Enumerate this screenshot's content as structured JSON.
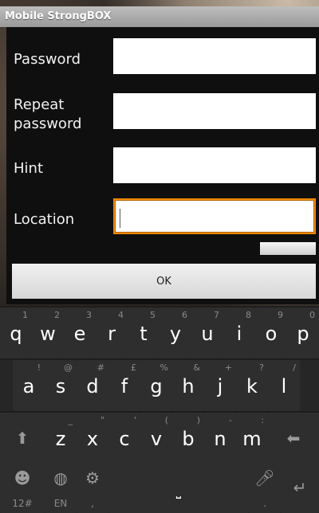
{
  "app": {
    "title": "Mobile StrongBOX"
  },
  "form": {
    "password_label": "Password",
    "repeat_label_1": "Repeat",
    "repeat_label_2": "password",
    "hint_label": "Hint",
    "location_label": "Location",
    "password_value": "",
    "repeat_value": "",
    "hint_value": "",
    "location_value": "",
    "ok_label": "OK"
  },
  "keyboard": {
    "row1": [
      {
        "key": "q",
        "hint": "1"
      },
      {
        "key": "w",
        "hint": "2"
      },
      {
        "key": "e",
        "hint": "3"
      },
      {
        "key": "r",
        "hint": "4"
      },
      {
        "key": "t",
        "hint": "5"
      },
      {
        "key": "y",
        "hint": "6"
      },
      {
        "key": "u",
        "hint": "7"
      },
      {
        "key": "i",
        "hint": "8"
      },
      {
        "key": "o",
        "hint": "9"
      },
      {
        "key": "p",
        "hint": "0"
      }
    ],
    "row2": [
      {
        "key": "a",
        "hint": "!"
      },
      {
        "key": "s",
        "hint": "@"
      },
      {
        "key": "d",
        "hint": "#"
      },
      {
        "key": "f",
        "hint": "£"
      },
      {
        "key": "g",
        "hint": "%"
      },
      {
        "key": "h",
        "hint": "&"
      },
      {
        "key": "j",
        "hint": "+"
      },
      {
        "key": "k",
        "hint": "?"
      },
      {
        "key": "l",
        "hint": "/"
      }
    ],
    "row3": [
      {
        "key": "z",
        "hint": "_"
      },
      {
        "key": "x",
        "hint": "\""
      },
      {
        "key": "c",
        "hint": "'"
      },
      {
        "key": "v",
        "hint": "("
      },
      {
        "key": "b",
        "hint": ")"
      },
      {
        "key": "n",
        "hint": "-"
      },
      {
        "key": "m",
        "hint": ":"
      }
    ],
    "bottom": {
      "sym_label": "12#",
      "lang_label": "EN",
      "comma_label": ",",
      "period_label": "."
    }
  }
}
